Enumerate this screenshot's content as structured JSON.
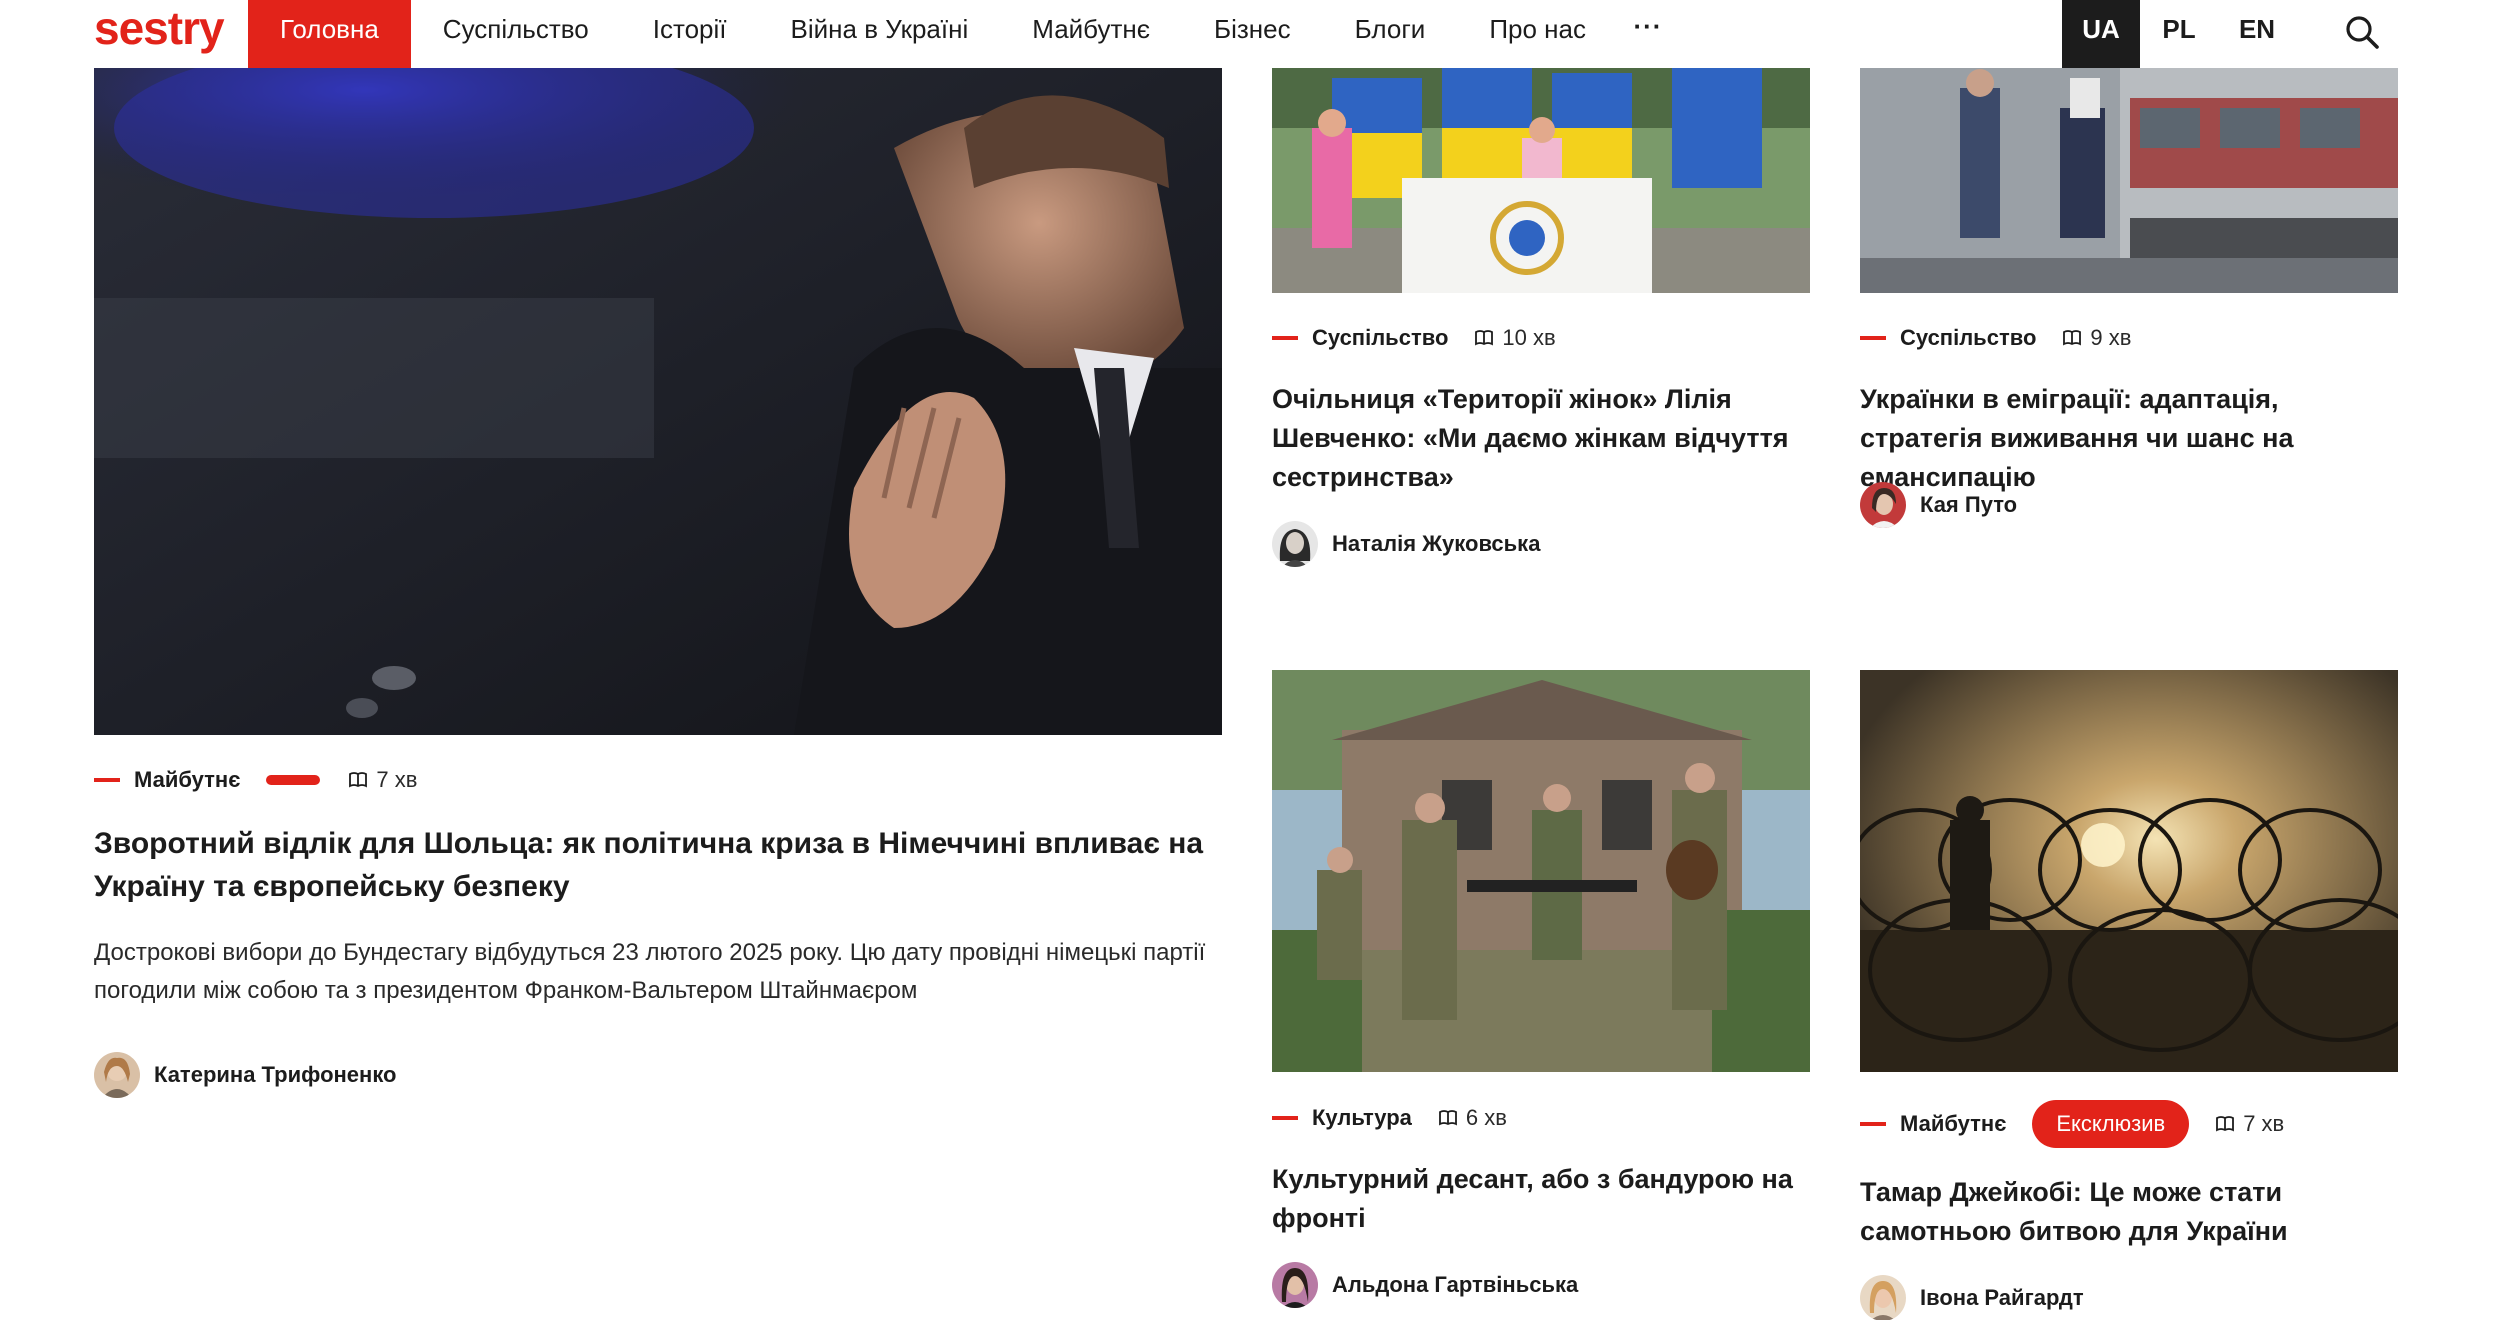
{
  "header": {
    "logo": "sestry",
    "nav": [
      "Головна",
      "Суспільство",
      "Історії",
      "Війна в Україні",
      "Майбутнє",
      "Бізнес",
      "Блоги",
      "Про нас"
    ],
    "more": "···",
    "langs": [
      "UA",
      "PL",
      "EN"
    ],
    "active_lang": "UA",
    "accent": "#e2231a"
  },
  "articles": [
    {
      "category": "Майбутнє",
      "read_time": "7 хв",
      "title": "Зворотний відлік для Шольца: як політична криза в Німеччині впливає на Україну та європейську безпеку",
      "lead": "Дострокові вибори до Бундестагу відбудуться 23 лютого 2025 року. Цю дату провідні німецькі партії погодили між собою та з президентом Франком-Вальтером Штайнмаєром",
      "author": "Катерина Трифоненко"
    },
    {
      "category": "Суспільство",
      "read_time": "10 хв",
      "title": "Очільниця «Території жінок» Лілія Шевченко: «Ми даємо жінкам відчуття сестринства»",
      "author": "Наталія Жуковська"
    },
    {
      "category": "Суспільство",
      "read_time": "9 хв",
      "title": "Українки в еміграції: адаптація, стратегія виживання чи шанс на емансипацію",
      "author": "Кая Путо"
    },
    {
      "category": "Культура",
      "read_time": "6 хв",
      "title": "Культурний десант, або з бандурою на фронті",
      "author": "Альдона Гартвіньська"
    },
    {
      "category": "Майбутнє",
      "badge": "Ексклюзив",
      "read_time": "7 хв",
      "title": "Тамар Джейкобі: Це може стати самотньою битвою для України",
      "author": "Івона Райгардт"
    }
  ]
}
